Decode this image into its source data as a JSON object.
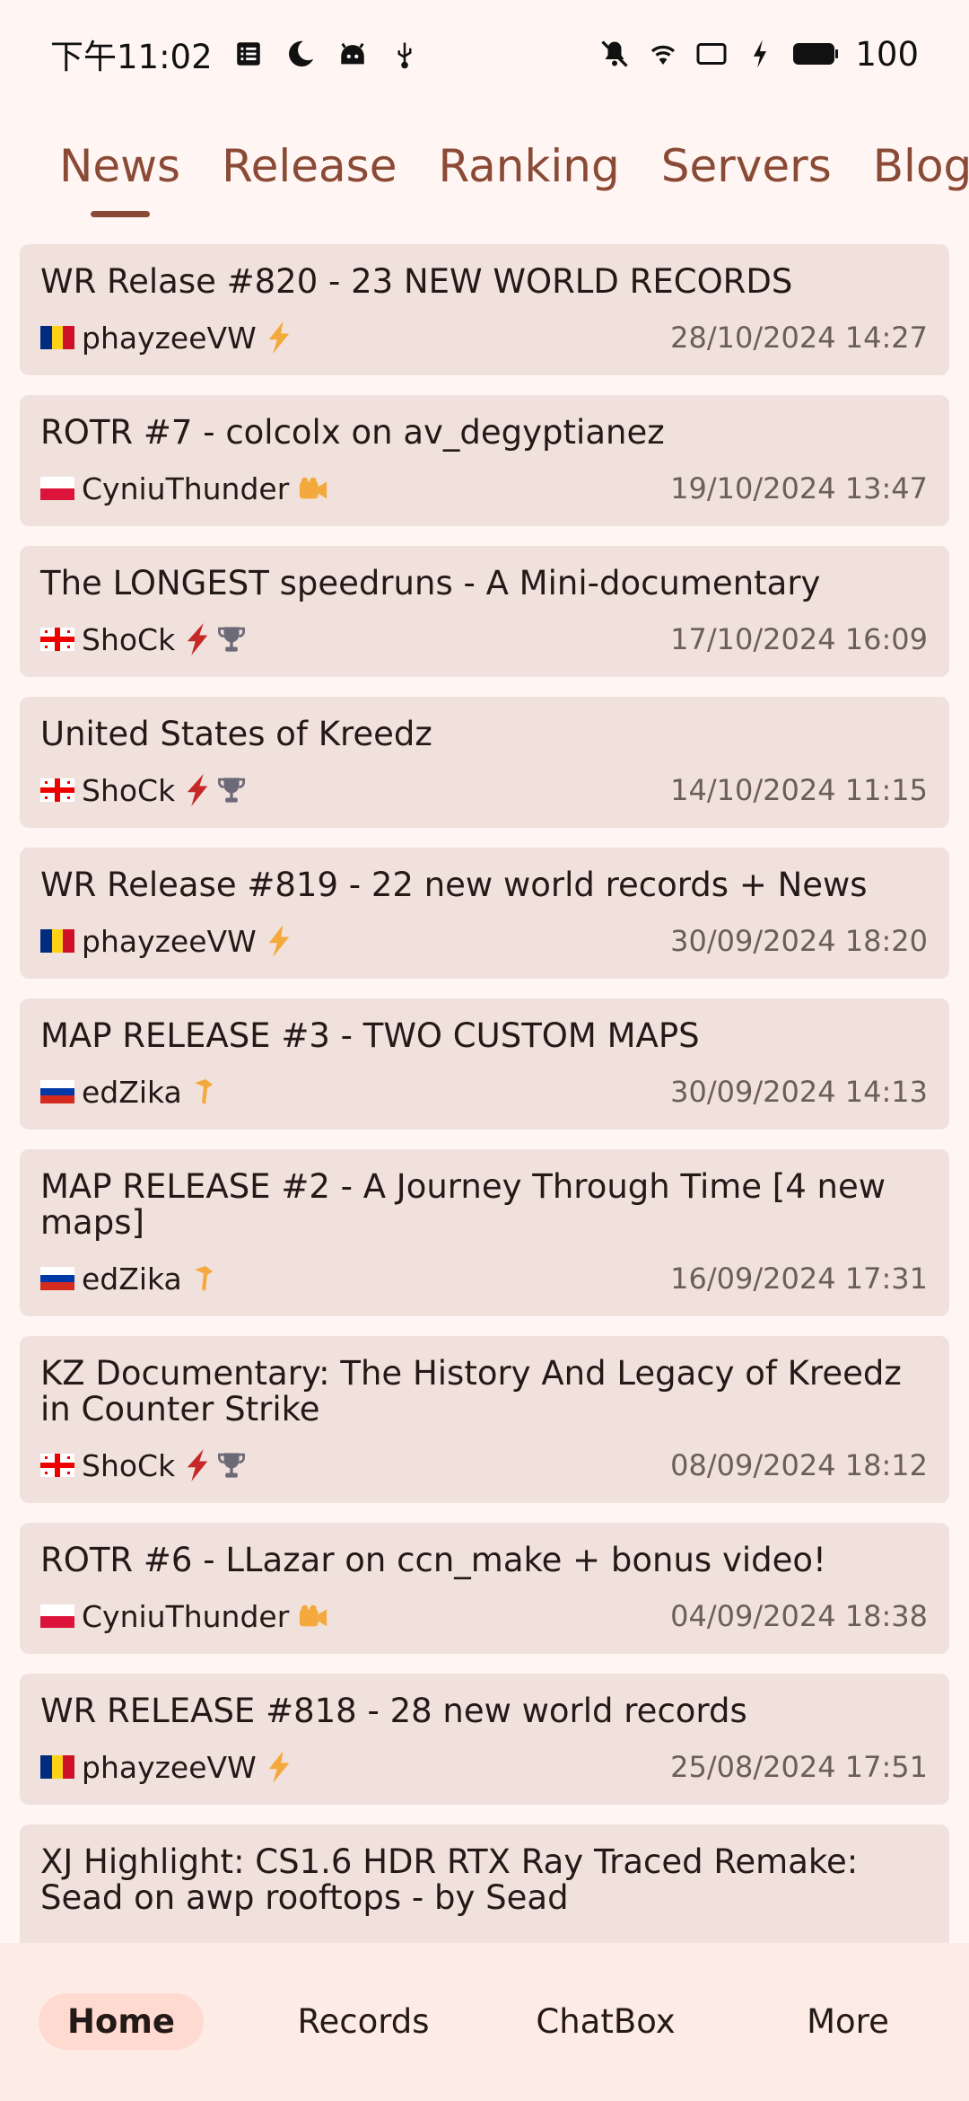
{
  "status_bar": {
    "time": "下午11:02",
    "battery": "100",
    "left_icons": [
      "notes-icon",
      "moon-icon",
      "android-icon",
      "usb-icon"
    ],
    "right_icons": [
      "mute-icon",
      "wifi-icon",
      "cast-icon",
      "charging-icon",
      "battery-icon"
    ]
  },
  "tabs": [
    {
      "label": "News",
      "active": true
    },
    {
      "label": "Release",
      "active": false
    },
    {
      "label": "Ranking",
      "active": false
    },
    {
      "label": "Servers",
      "active": false
    },
    {
      "label": "Blog",
      "active": false
    }
  ],
  "news": [
    {
      "title": "WR Relase #820 - 23 NEW WORLD RECORDS",
      "author": "phayzeeVW",
      "country": "ro",
      "roles": [
        "bolt-icon"
      ],
      "date": "28/10/2024 14:27"
    },
    {
      "title": "ROTR #7 - colcolx on av_degyptianez",
      "author": "CyniuThunder",
      "country": "pl",
      "roles": [
        "video-camera-icon"
      ],
      "date": "19/10/2024 13:47"
    },
    {
      "title": "The LONGEST speedruns - A Mini-documentary",
      "author": "ShoCk",
      "country": "ge",
      "roles": [
        "red-bolt-icon",
        "trophy-icon"
      ],
      "date": "17/10/2024 16:09"
    },
    {
      "title": "United States of Kreedz",
      "author": "ShoCk",
      "country": "ge",
      "roles": [
        "red-bolt-icon",
        "trophy-icon"
      ],
      "date": "14/10/2024 11:15"
    },
    {
      "title": "WR Release #819 - 22 new world records + News",
      "author": "phayzeeVW",
      "country": "ro",
      "roles": [
        "bolt-icon"
      ],
      "date": "30/09/2024 18:20"
    },
    {
      "title": "MAP RELEASE #3 - TWO CUSTOM MAPS",
      "author": "edZika",
      "country": "ru",
      "roles": [
        "hammer-icon"
      ],
      "date": "30/09/2024 14:13"
    },
    {
      "title": "MAP RELEASE #2 - A Journey Through Time [4 new maps]",
      "author": "edZika",
      "country": "ru",
      "roles": [
        "hammer-icon"
      ],
      "date": "16/09/2024 17:31"
    },
    {
      "title": "KZ Documentary: The History And Legacy of Kreedz in Counter Strike",
      "author": "ShoCk",
      "country": "ge",
      "roles": [
        "red-bolt-icon",
        "trophy-icon"
      ],
      "date": "08/09/2024 18:12"
    },
    {
      "title": "ROTR #6 - LLazar on ccn_make + bonus video!",
      "author": "CyniuThunder",
      "country": "pl",
      "roles": [
        "video-camera-icon"
      ],
      "date": "04/09/2024 18:38"
    },
    {
      "title": "WR RELEASE #818 - 28 new world records",
      "author": "phayzeeVW",
      "country": "ro",
      "roles": [
        "bolt-icon"
      ],
      "date": "25/08/2024 17:51"
    },
    {
      "title": "XJ Highlight: CS1.6 HDR RTX Ray Traced Remake: Sead on awp rooftops - by Sead",
      "author": "",
      "country": "",
      "roles": [],
      "date": ""
    }
  ],
  "bottom_nav": [
    {
      "label": "Home",
      "active": true
    },
    {
      "label": "Records",
      "active": false
    },
    {
      "label": "ChatBox",
      "active": false
    },
    {
      "label": "More",
      "active": false
    }
  ],
  "colors": {
    "accent": "#8a4a35",
    "card_bg": "#f1e1dc",
    "page_bg": "#fff6f3",
    "nav_bg": "#fdebe5",
    "nav_active_pill": "#ffdad0"
  }
}
